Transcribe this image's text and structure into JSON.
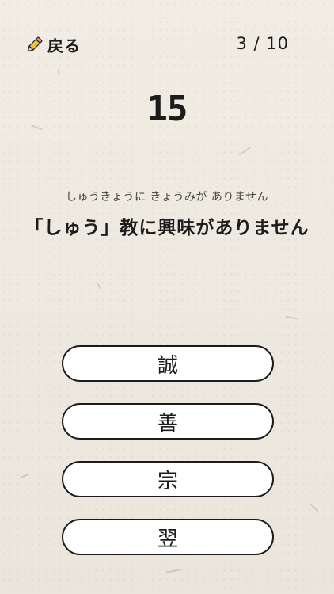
{
  "header": {
    "back_icon": "pencil-icon",
    "back_label": "戻る",
    "progress": "3 / 10"
  },
  "quiz": {
    "counter": "15",
    "reading": "しゅうきょうに きょうみが ありません",
    "question": "「しゅう」教に興味がありません"
  },
  "answers": [
    {
      "label": "誠"
    },
    {
      "label": "善"
    },
    {
      "label": "宗"
    },
    {
      "label": "翌"
    }
  ],
  "colors": {
    "background": "#efeae0",
    "text": "#1c1c1c",
    "button_fill": "#ffffff",
    "pencil_body": "#f2c12e",
    "pencil_tip": "#e8c9a0"
  }
}
